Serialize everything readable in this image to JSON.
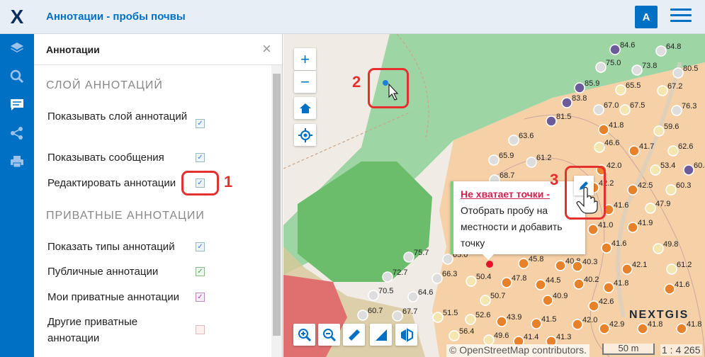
{
  "header": {
    "logo": "X",
    "title": "Аннотации - пробы почвы",
    "avatar": "A"
  },
  "leftbar": {
    "icons": [
      "layers-icon",
      "search-icon",
      "comment-icon",
      "share-icon",
      "print-icon"
    ]
  },
  "panel": {
    "title": "Аннотации",
    "close": "×",
    "section1": "СЛОЙ АННОТАЦИЙ",
    "row1": "Показывать слой аннотаций",
    "row2": "Показывать сообщения",
    "row3": "Редактировать аннотации",
    "section2": "ПРИВАТНЫЕ АННОТАЦИИ",
    "row4": "Показать типы аннотаций",
    "row5": "Публичные аннотации",
    "row6": "Мои приватные аннотации",
    "row7": "Другие приватные аннотации",
    "checked": [
      true,
      true,
      true,
      true,
      true,
      true,
      false
    ]
  },
  "markers": {
    "one": "1",
    "two": "2",
    "three": "3"
  },
  "map": {
    "popup_title": "Не хватает точки -",
    "popup_text": "Отобрать пробу на местности и добавить точку",
    "attribution": "© OpenStreetMap contributors.",
    "scale": "50 m",
    "scale_ratio": "1 : 4 265",
    "watermark": "NEXTGIS",
    "points": [
      {
        "v": "84.6",
        "c": "#6b5b9a"
      },
      {
        "v": "64.8",
        "c": "#ddd"
      },
      {
        "v": "75.0",
        "c": "#ddd"
      },
      {
        "v": "73.8",
        "c": "#ddd"
      },
      {
        "v": "80.5",
        "c": "#ddd"
      },
      {
        "v": "85.9",
        "c": "#6b5b9a"
      },
      {
        "v": "65.5",
        "c": "#f5e6b0"
      },
      {
        "v": "67.2",
        "c": "#f5e6b0"
      },
      {
        "v": "67.5",
        "c": "#f5e6b0"
      },
      {
        "v": "83.8",
        "c": "#6b5b9a"
      },
      {
        "v": "67.0",
        "c": "#ddd"
      },
      {
        "v": "76.3",
        "c": "#ddd"
      },
      {
        "v": "81.5",
        "c": "#6b5b9a"
      },
      {
        "v": "41.8",
        "c": "#e8822a"
      },
      {
        "v": "59.6",
        "c": "#f5e6b0"
      },
      {
        "v": "63.6",
        "c": "#ddd"
      },
      {
        "v": "46.6",
        "c": "#f5e6b0"
      },
      {
        "v": "41.7",
        "c": "#e8822a"
      },
      {
        "v": "62.6",
        "c": "#f5e6b0"
      },
      {
        "v": "65.9",
        "c": "#ddd"
      },
      {
        "v": "61.2",
        "c": "#ddd"
      },
      {
        "v": "42.0",
        "c": "#e8822a"
      },
      {
        "v": "53.4",
        "c": "#f5e6b0"
      },
      {
        "v": "60.4",
        "c": "#6b5b9a"
      },
      {
        "v": "68.7",
        "c": "#ddd"
      },
      {
        "v": "42.2",
        "c": "#e8822a"
      },
      {
        "v": "42.5",
        "c": "#e8822a"
      },
      {
        "v": "60.3",
        "c": "#f5e6b0"
      },
      {
        "v": "41.6",
        "c": "#e8822a"
      },
      {
        "v": "47.9",
        "c": "#f5e6b0"
      },
      {
        "v": "41.0",
        "c": "#e8822a"
      },
      {
        "v": "41.9",
        "c": "#e8822a"
      },
      {
        "v": "41.6",
        "c": "#e8822a"
      },
      {
        "v": "49.8",
        "c": "#f5e6b0"
      },
      {
        "v": "65.0",
        "c": "#ddd"
      },
      {
        "v": "75.7",
        "c": "#ddd"
      },
      {
        "v": "45.8",
        "c": "#e8822a"
      },
      {
        "v": "40.8",
        "c": "#e8822a"
      },
      {
        "v": "40.3",
        "c": "#e8822a"
      },
      {
        "v": "42.1",
        "c": "#e8822a"
      },
      {
        "v": "61.2",
        "c": "#f5e6b0"
      },
      {
        "v": "66.3",
        "c": "#ddd"
      },
      {
        "v": "72.7",
        "c": "#ddd"
      },
      {
        "v": "50.4",
        "c": "#f5e6b0"
      },
      {
        "v": "47.8",
        "c": "#e8822a"
      },
      {
        "v": "44.5",
        "c": "#e8822a"
      },
      {
        "v": "40.2",
        "c": "#e8822a"
      },
      {
        "v": "41.8",
        "c": "#e8822a"
      },
      {
        "v": "41.6",
        "c": "#e8822a"
      },
      {
        "v": "70.5",
        "c": "#ddd"
      },
      {
        "v": "64.6",
        "c": "#ddd"
      },
      {
        "v": "50.7",
        "c": "#f5e6b0"
      },
      {
        "v": "40.9",
        "c": "#e8822a"
      },
      {
        "v": "42.6",
        "c": "#e8822a"
      },
      {
        "v": "60.7",
        "c": "#ddd"
      },
      {
        "v": "67.7",
        "c": "#ddd"
      },
      {
        "v": "51.5",
        "c": "#f5e6b0"
      },
      {
        "v": "52.6",
        "c": "#f5e6b0"
      },
      {
        "v": "43.9",
        "c": "#e8822a"
      },
      {
        "v": "41.5",
        "c": "#e8822a"
      },
      {
        "v": "42.0",
        "c": "#e8822a"
      },
      {
        "v": "56.4",
        "c": "#f5e6b0"
      },
      {
        "v": "49.6",
        "c": "#f5e6b0"
      },
      {
        "v": "41.4",
        "c": "#e8822a"
      },
      {
        "v": "41.3",
        "c": "#e8822a"
      },
      {
        "v": "42.9",
        "c": "#e8822a"
      },
      {
        "v": "41.8",
        "c": "#e8822a"
      },
      {
        "v": "41.8",
        "c": "#e8822a"
      }
    ]
  }
}
